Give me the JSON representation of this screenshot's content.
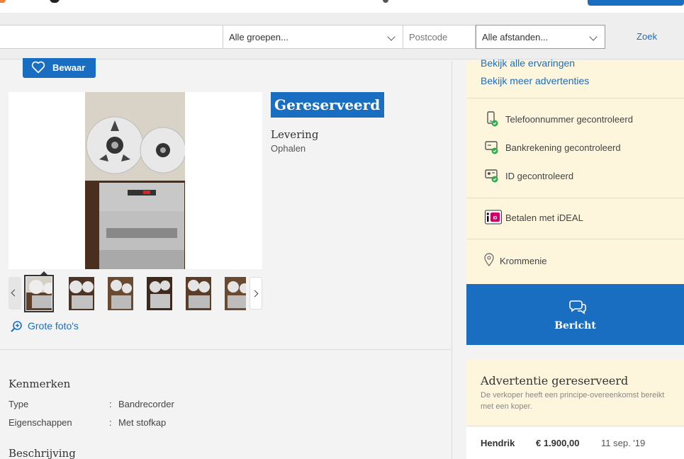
{
  "search": {
    "group_select": "Alle groepen...",
    "postcode_placeholder": "Postcode",
    "distance_select": "Alle afstanden...",
    "search_button": "Zoek"
  },
  "listing": {
    "save_button": "Bewaar",
    "status": "Gereserveerd",
    "delivery_heading": "Levering",
    "delivery_method": "Ophalen",
    "photos_link": "Grote foto's",
    "thumbnail_count": 6
  },
  "features": {
    "heading": "Kenmerken",
    "rows": [
      {
        "label": "Type",
        "value": "Bandrecorder"
      },
      {
        "label": "Eigenschappen",
        "value": "Met stofkap"
      }
    ],
    "separator": ":"
  },
  "description": {
    "heading": "Beschrijving"
  },
  "seller": {
    "links": [
      "Bekijk alle ervaringen",
      "Bekijk meer advertenties"
    ],
    "verifications": [
      "Telefoonnummer gecontroleerd",
      "Bankrekening gecontroleerd",
      "ID gecontroleerd"
    ],
    "payment": "Betalen met iDEAL",
    "ideal_logo_text": "iD",
    "location": "Krommenie",
    "message_button": "Bericht"
  },
  "reservation": {
    "title": "Advertentie gereserveerd",
    "subtitle": "De verkoper heeft een principe-overeenkomst bereikt met een koper.",
    "buyer": "Hendrik",
    "price": "€ 1.900,00",
    "date": "11 sep. '19"
  },
  "colors": {
    "accent": "#1a6ec2",
    "sidebar_bg": "#fdf6dc",
    "verified_check": "#2eab4b",
    "ideal_pink": "#cc0066"
  }
}
